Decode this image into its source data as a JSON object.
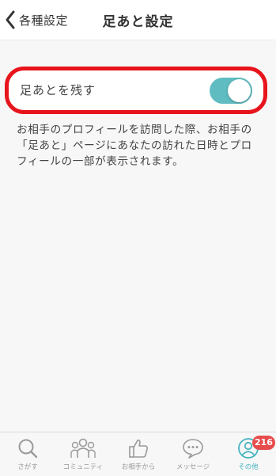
{
  "nav": {
    "back_label": "各種設定",
    "title": "足あと設定"
  },
  "setting": {
    "label": "足あとを残す",
    "toggle_on": true
  },
  "description": "お相手のプロフィールを訪問した際、お相手の「足あと」ページにあなたの訪れた日時とプロフィールの一部が表示されます。",
  "tabs": [
    {
      "label": "さがす",
      "icon": "search-icon"
    },
    {
      "label": "コミュニティ",
      "icon": "community-icon"
    },
    {
      "label": "お相手から",
      "icon": "thumbs-up-icon"
    },
    {
      "label": "メッセージ",
      "icon": "message-icon"
    },
    {
      "label": "その他",
      "icon": "person-icon",
      "badge": "216"
    }
  ],
  "colors": {
    "accent": "#45b5bf",
    "toggle": "#5fbcc1",
    "highlight": "#e8141c",
    "badge": "#e74c4c"
  }
}
